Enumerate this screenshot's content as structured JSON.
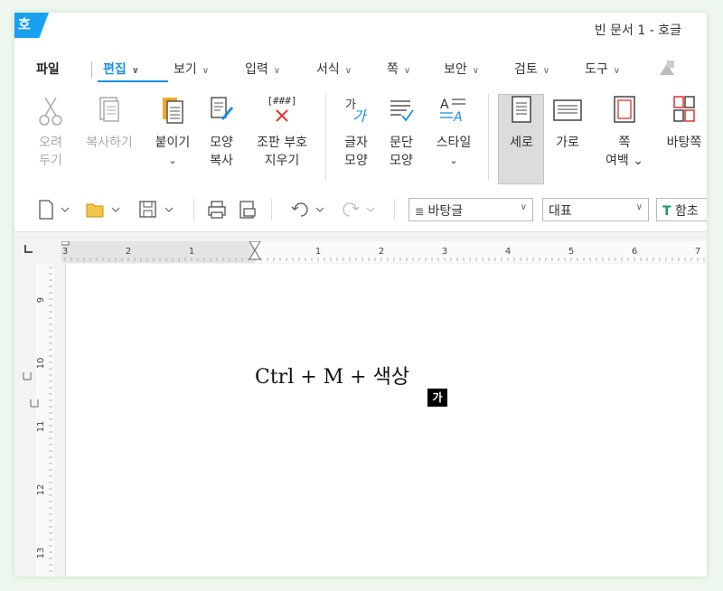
{
  "window": {
    "title": "빈 문서 1 - 호글",
    "logo_text": "호"
  },
  "menu": {
    "file": "파일",
    "items": [
      {
        "label": "편집",
        "active": true
      },
      {
        "label": "보기"
      },
      {
        "label": "입력"
      },
      {
        "label": "서식"
      },
      {
        "label": "쪽"
      },
      {
        "label": "보안"
      },
      {
        "label": "검토"
      },
      {
        "label": "도구"
      }
    ]
  },
  "ribbon": {
    "cut": [
      "오려",
      "두기"
    ],
    "copy": "복사하기",
    "paste": [
      "붙이기",
      "⌄"
    ],
    "format_copy": [
      "모양",
      "복사"
    ],
    "clear_codes": [
      "조판 부호",
      "지우기"
    ],
    "char_shape": [
      "글자",
      "모양"
    ],
    "para_shape": [
      "문단",
      "모양"
    ],
    "style": [
      "스타일",
      "⌄"
    ],
    "portrait": "세로",
    "landscape": "가로",
    "margins": [
      "쪽",
      "여백 ⌄"
    ],
    "master_page": "바탕쪽",
    "clear_codes_icon_text": "[###]"
  },
  "toolbar": {
    "style_select": "바탕글",
    "lang_select": "대표",
    "font_select": "함초"
  },
  "ruler": {
    "h_labels": [
      "3",
      "2",
      "1",
      "1",
      "2",
      "3",
      "4",
      "5",
      "6",
      "7"
    ],
    "v_labels": [
      "9",
      "10",
      "11",
      "12",
      "13"
    ]
  },
  "document": {
    "text": "Ctrl  +  M  +  색상",
    "ime_badge": "가"
  },
  "colors": {
    "accent": "#1a8fe0",
    "logo": "#1aa0f0",
    "cut_mark": "#e03030"
  }
}
